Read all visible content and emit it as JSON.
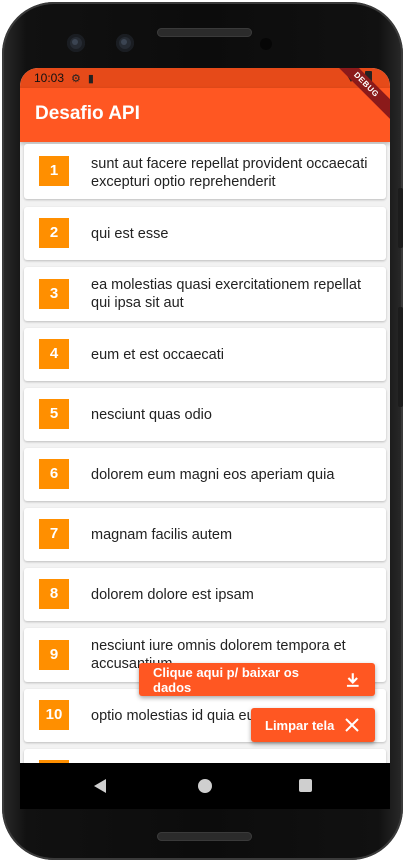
{
  "status_bar": {
    "time": "10:03",
    "debug_banner": "DEBUG"
  },
  "app_bar": {
    "title": "Desafio API"
  },
  "posts": [
    {
      "id": "1",
      "title": "sunt aut facere repellat provident occaecati excepturi optio reprehenderit"
    },
    {
      "id": "2",
      "title": "qui est esse"
    },
    {
      "id": "3",
      "title": "ea molestias quasi exercitationem repellat qui ipsa sit aut"
    },
    {
      "id": "4",
      "title": "eum et est occaecati"
    },
    {
      "id": "5",
      "title": "nesciunt quas odio"
    },
    {
      "id": "6",
      "title": "dolorem eum magni eos aperiam quia"
    },
    {
      "id": "7",
      "title": "magnam facilis autem"
    },
    {
      "id": "8",
      "title": "dolorem dolore est ipsam"
    },
    {
      "id": "9",
      "title": "nesciunt iure omnis dolorem tempora et accusantium"
    },
    {
      "id": "10",
      "title": "optio molestias id quia eum"
    }
  ],
  "actions": {
    "download_label": "Clique aqui p/ baixar os dados",
    "clear_label": "Limpar tela"
  },
  "colors": {
    "status_bar": "#e64a19",
    "app_bar": "#ff5722",
    "badge": "#ff8f00",
    "background": "#f2f2f2"
  },
  "icons": {
    "download": "download-icon",
    "clear": "close-icon",
    "status": [
      "settings-icon",
      "sim-icon",
      "wifi-icon",
      "battery-icon"
    ]
  }
}
